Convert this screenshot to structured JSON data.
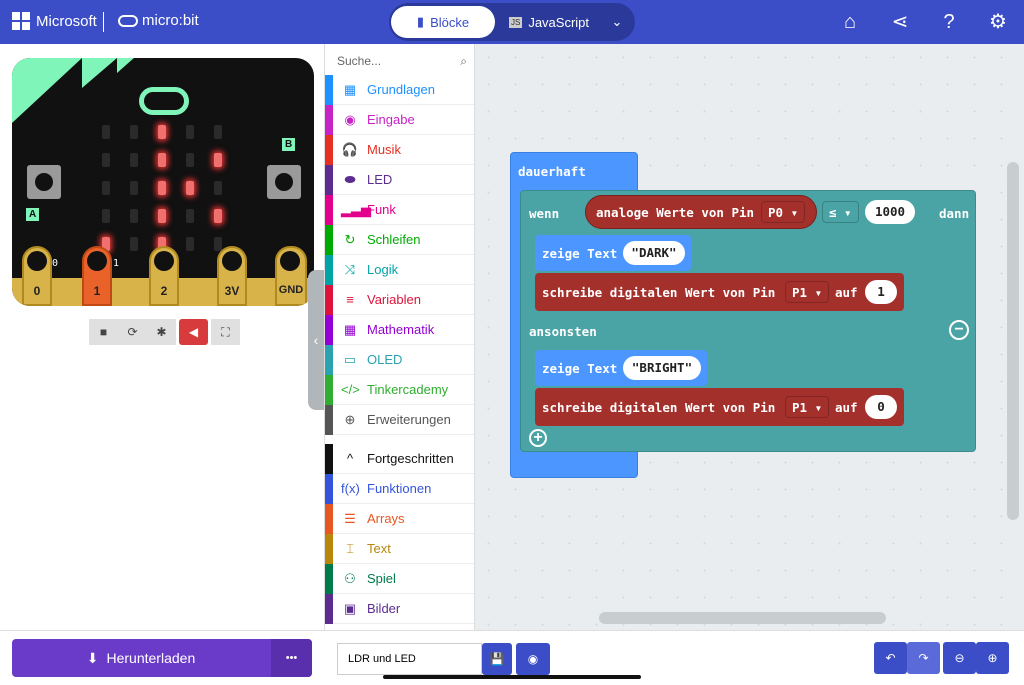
{
  "header": {
    "brand": "Microsoft",
    "product": "micro:bit",
    "tabs": [
      {
        "label": "Blöcke",
        "active": true
      },
      {
        "label": "JavaScript",
        "active": false
      }
    ],
    "icons": [
      "home-icon",
      "share-icon",
      "help-icon",
      "gear-icon"
    ],
    "color": "#3b4ec8"
  },
  "simulator": {
    "led_matrix": [
      [
        0,
        0,
        1,
        0,
        0
      ],
      [
        0,
        0,
        1,
        0,
        1
      ],
      [
        0,
        0,
        1,
        1,
        0
      ],
      [
        0,
        0,
        1,
        0,
        1
      ],
      [
        1,
        0,
        1,
        0,
        0
      ]
    ],
    "button_a": "A",
    "button_b": "B",
    "pins": [
      "0",
      "1",
      "2",
      "3V",
      "GND"
    ],
    "pin_values": [
      "0",
      "1"
    ],
    "controls": [
      "stop-icon",
      "restart-icon",
      "debug-icon",
      "mute-icon",
      "fullscreen-icon"
    ]
  },
  "toolbox": {
    "search_placeholder": "Suche...",
    "categories": [
      {
        "label": "Grundlagen",
        "color": "#1e90ff",
        "icon": "▦"
      },
      {
        "label": "Eingabe",
        "color": "#c724c7",
        "icon": "◉"
      },
      {
        "label": "Musik",
        "color": "#e63022",
        "icon": "🎧"
      },
      {
        "label": "LED",
        "color": "#5c2d91",
        "icon": "⬬"
      },
      {
        "label": "Funk",
        "color": "#e3008c",
        "icon": "▂▃▅"
      },
      {
        "label": "Schleifen",
        "color": "#00aa00",
        "icon": "↻"
      },
      {
        "label": "Logik",
        "color": "#00a4a6",
        "icon": "⤨"
      },
      {
        "label": "Variablen",
        "color": "#dc143c",
        "icon": "≡"
      },
      {
        "label": "Mathematik",
        "color": "#9400d3",
        "icon": "▦"
      },
      {
        "label": "OLED",
        "color": "#2aa2b0",
        "icon": "▭"
      },
      {
        "label": "Tinkercademy",
        "color": "#2fae2f",
        "icon": "</>"
      },
      {
        "label": "Erweiterungen",
        "color": "#555555",
        "icon": "⊕"
      }
    ],
    "advanced": [
      {
        "label": "Fortgeschritten",
        "color": "#111111",
        "icon": "^"
      },
      {
        "label": "Funktionen",
        "color": "#3455db",
        "icon": "f(x)"
      },
      {
        "label": "Arrays",
        "color": "#e65722",
        "icon": "☰"
      },
      {
        "label": "Text",
        "color": "#b8860b",
        "icon": "⌶"
      },
      {
        "label": "Spiel",
        "color": "#007a4b",
        "icon": "⚇"
      },
      {
        "label": "Bilder",
        "color": "#5c2d91",
        "icon": "▣"
      }
    ]
  },
  "workspace": {
    "forever": "dauerhaft",
    "if": "wenn",
    "then": "dann",
    "else": "ansonsten",
    "analog": "analoge Werte von Pin",
    "analog_pin": "P0",
    "op": "≤",
    "threshold": "1000",
    "show1": "zeige Text",
    "text1": "DARK",
    "write": "schreibe digitalen Wert von Pin",
    "pin1": "P1",
    "to": "auf",
    "val1": "1",
    "show2": "zeige Text",
    "text2": "BRIGHT",
    "pin2": "P1",
    "val2": "0"
  },
  "footer": {
    "download": "Herunterladen",
    "more": "•••",
    "project_name": "LDR und LED"
  }
}
